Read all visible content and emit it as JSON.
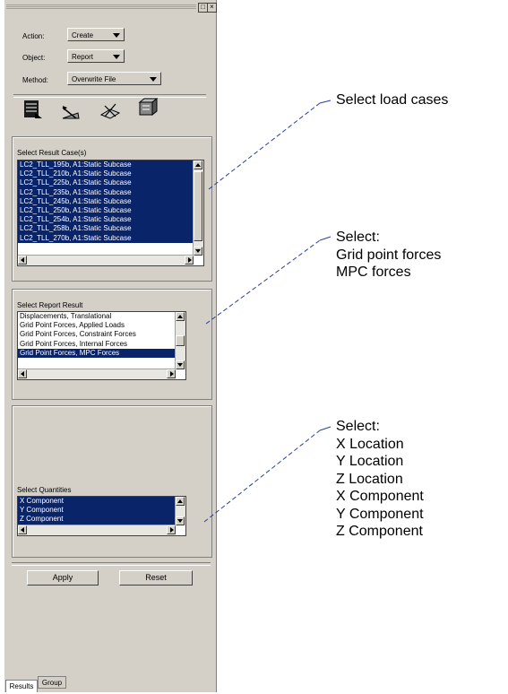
{
  "form": {
    "action": {
      "label": "Action:",
      "value": "Create"
    },
    "object": {
      "label": "Object:",
      "value": "Report"
    },
    "method": {
      "label": "Method:",
      "value": "Overwrite File"
    },
    "icons": [
      "select-results-icon",
      "target-entities-icon",
      "display-attributes-icon",
      "report-options-icon"
    ]
  },
  "result_cases": {
    "title": "Select Result Case(s)",
    "items": [
      "LC2_TLL_195b, A1:Static Subcase",
      "LC2_TLL_210b, A1:Static Subcase",
      "LC2_TLL_225b, A1:Static Subcase",
      "LC2_TLL_235b, A1:Static Subcase",
      "LC2_TLL_245b, A1:Static Subcase",
      "LC2_TLL_250b, A1:Static Subcase",
      "LC2_TLL_254b, A1:Static Subcase",
      "LC2_TLL_258b, A1:Static Subcase",
      "LC2_TLL_270b, A1:Static Subcase"
    ]
  },
  "report_result": {
    "title": "Select Report Result",
    "items": [
      "Displacements, Translational",
      "Grid Point Forces, Applied Loads",
      "Grid Point Forces, Constraint Forces",
      "Grid Point Forces, Internal Forces",
      "Grid Point Forces, MPC Forces"
    ],
    "selected_index": 4
  },
  "quantities": {
    "title": "Select Quantities",
    "items": [
      "X Component",
      "Y Component",
      "Z Component"
    ]
  },
  "buttons": {
    "apply": "Apply",
    "reset": "Reset"
  },
  "tabs": {
    "results": "Results",
    "group": "Group"
  },
  "callouts": {
    "load_cases": [
      "Select load cases"
    ],
    "forces": [
      "Select:",
      "Grid point forces",
      "MPC forces"
    ],
    "quantities": [
      "Select:",
      "X Location",
      "Y Location",
      "Z Location",
      "X Component",
      "Y Component",
      "Z Component"
    ]
  },
  "colors": {
    "panel": "#d4d0c8",
    "selection": "#0a246a",
    "annotation_line": "#2a3f9a"
  }
}
